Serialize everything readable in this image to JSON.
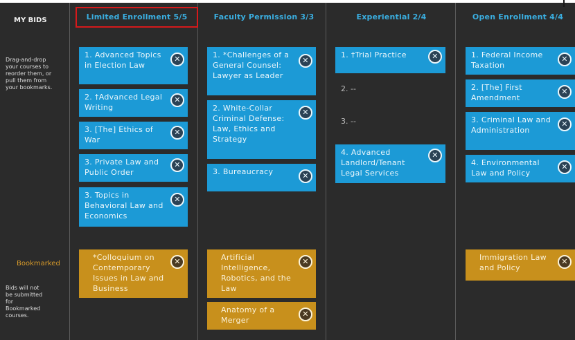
{
  "sidebar": {
    "title": "MY BIDS",
    "instructions": "Drag-and-drop your courses to reorder them, or pull them from your bookmarks.",
    "bookmarked_label": "Bookmarked",
    "bookmarked_note": "Bids will not be submitted for Bookmarked courses."
  },
  "columns": [
    {
      "header": "Limited Enrollment 5/5",
      "items": [
        "1. Advanced Topics in Election Law",
        "2. †Advanced Legal Writing",
        "3. [The] Ethics of War",
        "3. Private Law and Public Order",
        "3. Topics in Behavioral Law and Economics"
      ],
      "bookmarked": [
        "*Colloquium on Contemporary Issues in Law and Business"
      ]
    },
    {
      "header": "Faculty Permission 3/3",
      "items": [
        "1. *Challenges of a General Counsel: Lawyer as Leader",
        "2. White-Collar Criminal Defense: Law, Ethics and Strategy",
        "3. Bureaucracy"
      ],
      "bookmarked": [
        "Artificial Intelligence, Robotics, and the Law",
        "Anatomy of a Merger"
      ]
    },
    {
      "header": "Experiential 2/4",
      "items": [
        "1. †Trial Practice",
        "2. --",
        "3. --",
        "4. Advanced Landlord/Tenant Legal Services"
      ],
      "bookmarked": []
    },
    {
      "header": "Open Enrollment 4/4",
      "items": [
        "1. Federal Income Taxation",
        "2. [The] First Amendment",
        "3. Criminal Law and Administration",
        "4. Environmental Law and Policy"
      ],
      "bookmarked": [
        "Immigration Law and Policy"
      ]
    }
  ],
  "remove_icon": "x-circle-icon",
  "colors": {
    "accent": "#3aaee0",
    "card_blue": "#1c9ad6",
    "card_gold": "#c8901c",
    "highlight": "#d7191b"
  }
}
